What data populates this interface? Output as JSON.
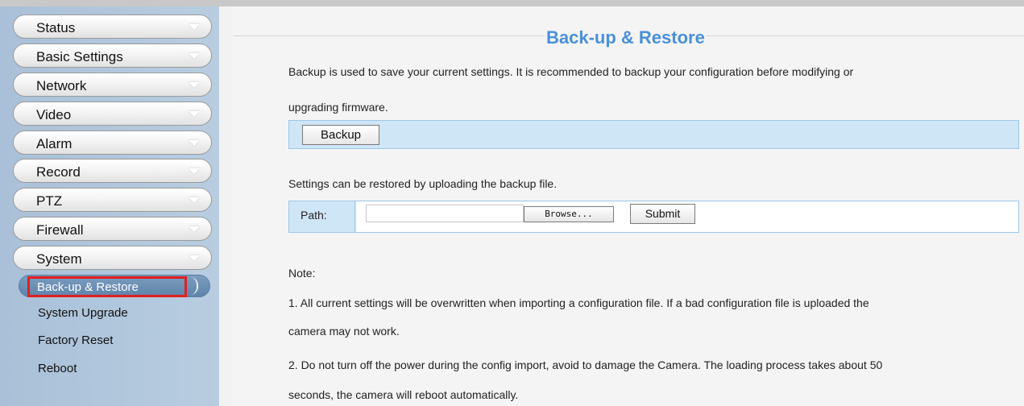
{
  "sidebar": {
    "menu": [
      {
        "label": "Status",
        "icon": "chevron-down-icon"
      },
      {
        "label": "Basic Settings",
        "icon": "chevron-down-icon"
      },
      {
        "label": "Network",
        "icon": "chevron-down-icon"
      },
      {
        "label": "Video",
        "icon": "chevron-down-icon"
      },
      {
        "label": "Alarm",
        "icon": "chevron-down-icon"
      },
      {
        "label": "Record",
        "icon": "chevron-down-icon"
      },
      {
        "label": "PTZ",
        "icon": "chevron-down-icon"
      },
      {
        "label": "Firewall",
        "icon": "chevron-down-icon"
      },
      {
        "label": "System",
        "icon": "chevron-down-icon"
      }
    ],
    "submenu": [
      {
        "label": "Back-up & Restore",
        "selected": true
      },
      {
        "label": "System Upgrade",
        "selected": false
      },
      {
        "label": "Factory Reset",
        "selected": false
      },
      {
        "label": "Reboot",
        "selected": false
      }
    ]
  },
  "main": {
    "title": "Back-up & Restore",
    "backup_desc_line1": "Backup is used to save your current settings. It is recommended to backup your configuration before modifying or",
    "backup_desc_line2": "upgrading firmware.",
    "backup_button": "Backup",
    "restore_desc": "Settings can be restored by uploading the backup file.",
    "path_label": "Path:",
    "path_value": "",
    "browse_button": "Browse...",
    "submit_button": "Submit",
    "note_title": "Note:",
    "note1_line1": "1. All current settings will be overwritten when importing a configuration file. If a bad configuration file is uploaded the",
    "note1_line2": "camera may not work.",
    "note2_line1": "2. Do not turn off the power during the config import, avoid to damage the Camera. The loading process takes about 50",
    "note2_line2": "seconds, the camera will reboot automatically."
  },
  "colors": {
    "title": "#4a90d9",
    "highlight_box": "#e02020",
    "section_bar": "#cfe6f7",
    "sidebar_bg": "#b8cde0"
  }
}
